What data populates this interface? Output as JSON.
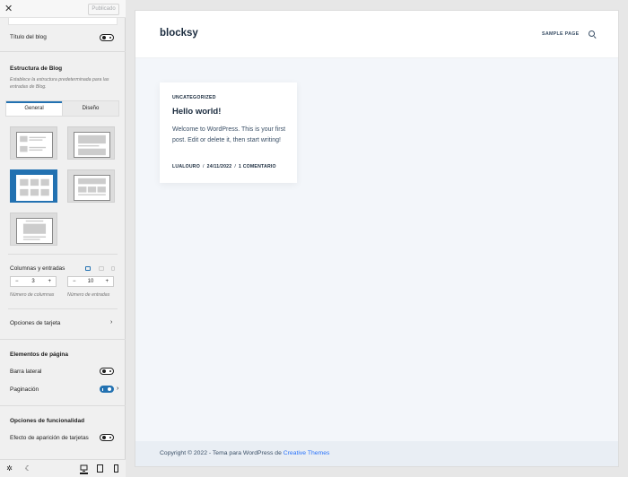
{
  "sidebar": {
    "header": {
      "close_label": "✕",
      "publish_label": "Publicado"
    },
    "blog_title": {
      "label": "Título del blog",
      "enabled": false
    },
    "structure": {
      "heading": "Estructura de Blog",
      "description": "Establece la estructura predeterminada para las entradas de Blog.",
      "tabs": [
        {
          "label": "General",
          "active": true
        },
        {
          "label": "Diseño",
          "active": false
        }
      ],
      "options": [
        {
          "name": "simple",
          "selected": false
        },
        {
          "name": "classic",
          "selected": false
        },
        {
          "name": "grid",
          "selected": true
        },
        {
          "name": "enhanced-grid",
          "selected": false
        },
        {
          "name": "gutenberg",
          "selected": false
        }
      ]
    },
    "columns": {
      "label": "Columnas y entradas",
      "columns_value": "3",
      "posts_value": "10",
      "columns_hint": "Número de columnas",
      "posts_hint": "Número de entradas",
      "minus": "−",
      "plus": "+"
    },
    "card_options": {
      "label": "Opciones de tarjeta"
    },
    "page_elements": {
      "heading": "Elementos de página",
      "sidebar_label": "Barra lateral",
      "sidebar_enabled": false,
      "pagination_label": "Paginación",
      "pagination_enabled": true
    },
    "functionality": {
      "heading": "Opciones de funcionalidad",
      "card_effect_label": "Efecto de aparición de tarjetas",
      "card_effect_enabled": false
    }
  },
  "preview": {
    "site_title": "blocksy",
    "nav": {
      "sample_page": "SAMPLE PAGE"
    },
    "post": {
      "category": "UNCATEGORIZED",
      "title": "Hello world!",
      "excerpt": "Welcome to WordPress. This is your first post. Edit or delete it, then start writing!",
      "author": "LUALOURO",
      "date": "24/11/2022",
      "comments": "1 COMENTARIO",
      "separator": "/"
    },
    "footer": {
      "text": "Copyright © 2022 - Tema para WordPress de ",
      "link": "Creative Themes"
    }
  },
  "colors": {
    "accent": "#2271b1",
    "link": "#2872fa",
    "title": "#192a3d"
  }
}
